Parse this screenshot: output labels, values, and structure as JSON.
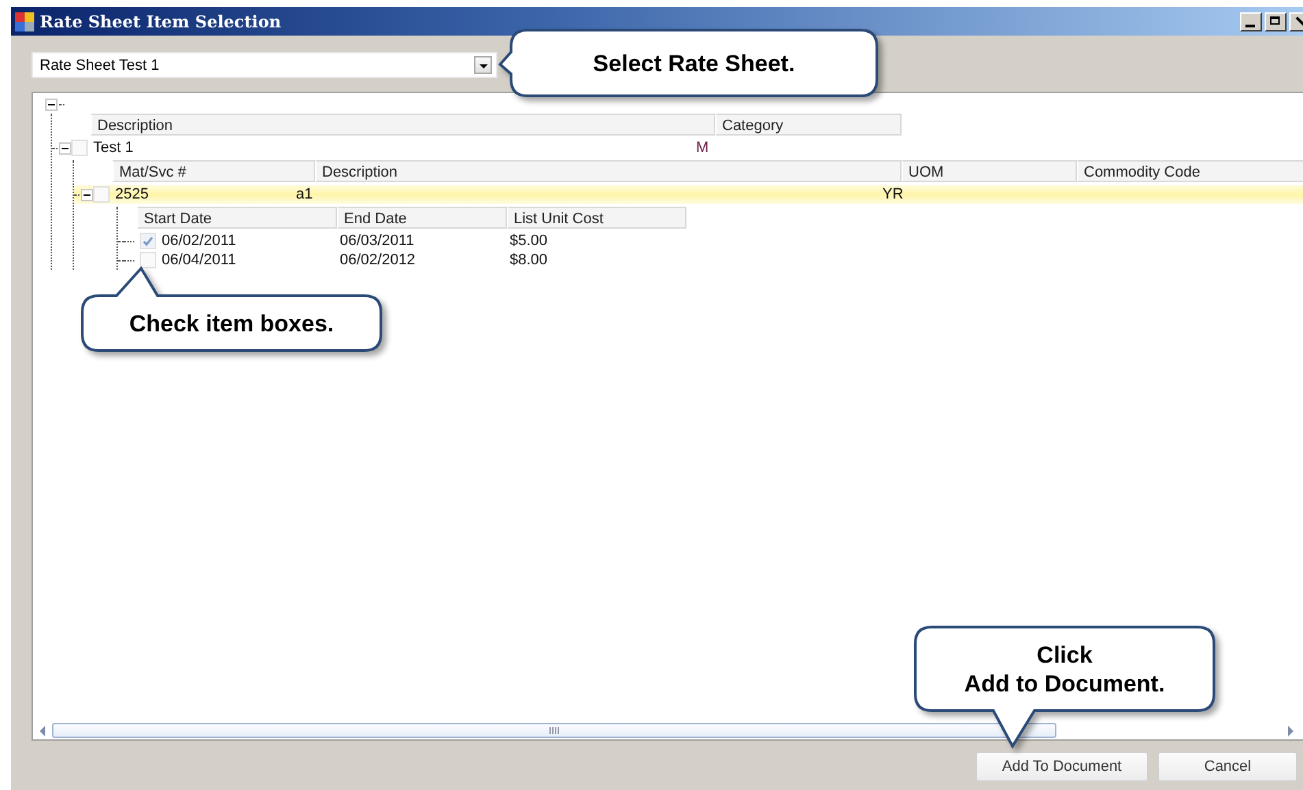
{
  "window": {
    "title": "Rate Sheet Item Selection"
  },
  "rate_sheet_select": {
    "value": "Rate Sheet Test 1"
  },
  "tree": {
    "expanded": true,
    "columns": [
      "Description",
      "Category"
    ],
    "children": [
      {
        "cells": [
          "Test 1",
          "M"
        ],
        "checked": false,
        "expanded": true,
        "columns": [
          "Mat/Svc #",
          "Description",
          "UOM",
          "Commodity Code"
        ],
        "children": [
          {
            "cells": [
              "2525",
              "a1",
              "YR"
            ],
            "checked": false,
            "expanded": true,
            "selected": true,
            "columns": [
              "Start Date",
              "End Date",
              "List Unit Cost"
            ],
            "children": [
              {
                "cells": [
                  "06/02/2011",
                  "06/03/2011",
                  "$5.00"
                ],
                "checked": true
              },
              {
                "cells": [
                  "06/04/2011",
                  "06/02/2012",
                  "$8.00"
                ],
                "checked": false
              }
            ]
          }
        ]
      }
    ]
  },
  "buttons": [
    "Add To Document",
    "Cancel"
  ],
  "callouts": [
    {
      "lines": [
        "Select Rate Sheet."
      ]
    },
    {
      "lines": [
        "Check item boxes."
      ]
    },
    {
      "lines": [
        "Click",
        "Add to Document."
      ]
    }
  ]
}
